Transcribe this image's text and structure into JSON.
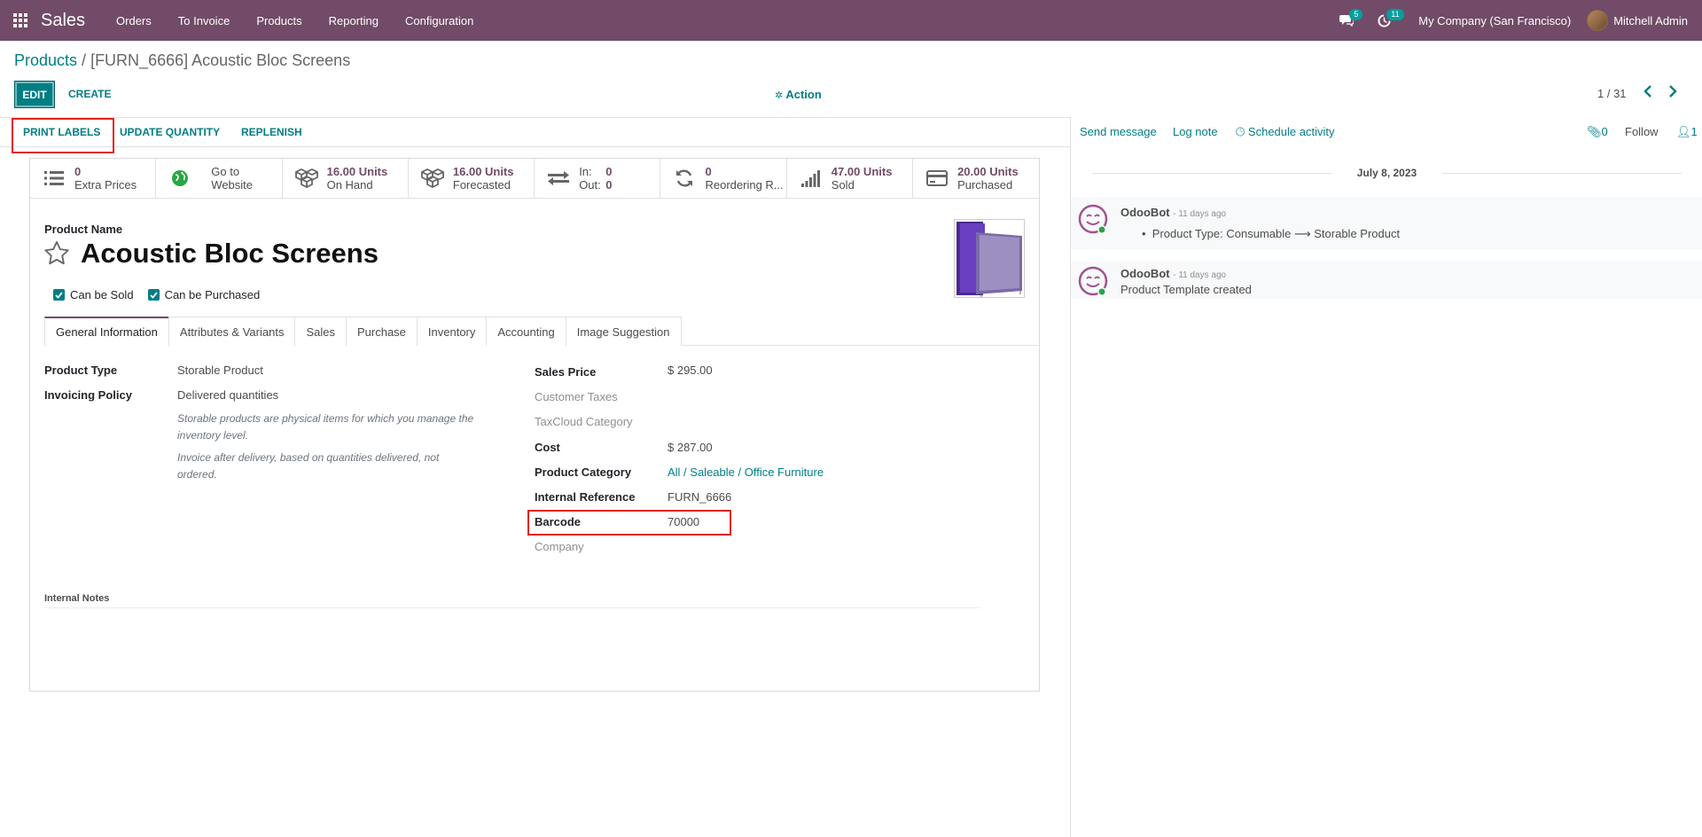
{
  "nav": {
    "brand": "Sales",
    "items": [
      "Orders",
      "To Invoice",
      "Products",
      "Reporting",
      "Configuration"
    ],
    "messages_count": "5",
    "activities_count": "11",
    "company": "My Company (San Francisco)",
    "user": "Mitchell Admin"
  },
  "control": {
    "breadcrumb_parent": "Products",
    "breadcrumb_sep": " / ",
    "breadcrumb_current": "[FURN_6666] Acoustic Bloc Screens",
    "edit_label": "EDIT",
    "create_label": "CREATE",
    "action_label": "Action",
    "pager": "1 / 31"
  },
  "statusbar": {
    "print_labels": "PRINT LABELS",
    "update_quantity": "UPDATE QUANTITY",
    "replenish": "REPLENISH"
  },
  "stats": {
    "extra_prices_value": "0",
    "extra_prices_label": "Extra Prices",
    "website_l1": "Go to",
    "website_l2": "Website",
    "on_hand_value": "16.00 Units",
    "on_hand_label": "On Hand",
    "forecasted_value": "16.00 Units",
    "forecasted_label": "Forecasted",
    "in_label": "In:",
    "in_value": "0",
    "out_label": "Out:",
    "out_value": "0",
    "reordering_value": "0",
    "reordering_label": "Reordering R...",
    "sold_value": "47.00 Units",
    "sold_label": "Sold",
    "purchased_value": "20.00 Units",
    "purchased_label": "Purchased"
  },
  "product": {
    "name_label": "Product Name",
    "name": "Acoustic Bloc Screens",
    "can_be_sold": "Can be Sold",
    "can_be_purchased": "Can be Purchased"
  },
  "tabs": [
    "General Information",
    "Attributes & Variants",
    "Sales",
    "Purchase",
    "Inventory",
    "Accounting",
    "Image Suggestion"
  ],
  "general": {
    "product_type_label": "Product Type",
    "product_type": "Storable Product",
    "invoicing_policy_label": "Invoicing Policy",
    "invoicing_policy": "Delivered quantities",
    "help1_l1": "Storable products are physical items for which you manage the",
    "help1_l2": "inventory level.",
    "help2_l1": "Invoice after delivery, based on quantities delivered, not",
    "help2_l2": "ordered.",
    "sales_price_label": "Sales Price",
    "sales_price": "$ 295.00",
    "customer_taxes_label": "Customer Taxes",
    "taxcloud_label": "TaxCloud Category",
    "cost_label": "Cost",
    "cost": "$ 287.00",
    "category_label": "Product Category",
    "category": "All / Saleable / Office Furniture",
    "internal_ref_label": "Internal Reference",
    "internal_ref": "FURN_6666",
    "barcode_label": "Barcode",
    "barcode": "70000",
    "company_label": "Company",
    "internal_notes_label": "Internal Notes"
  },
  "chatter": {
    "send_message": "Send message",
    "log_note": "Log note",
    "schedule_activity": "Schedule activity",
    "attachments": "0",
    "follow": "Follow",
    "followers": "1",
    "date": "July 8, 2023",
    "messages": [
      {
        "author": "OdooBot",
        "time": "- 11 days ago",
        "body_from": "Product Type: Consumable",
        "body_to": "Storable Product"
      },
      {
        "author": "OdooBot",
        "time": "- 11 days ago",
        "body": "Product Template created"
      }
    ]
  }
}
